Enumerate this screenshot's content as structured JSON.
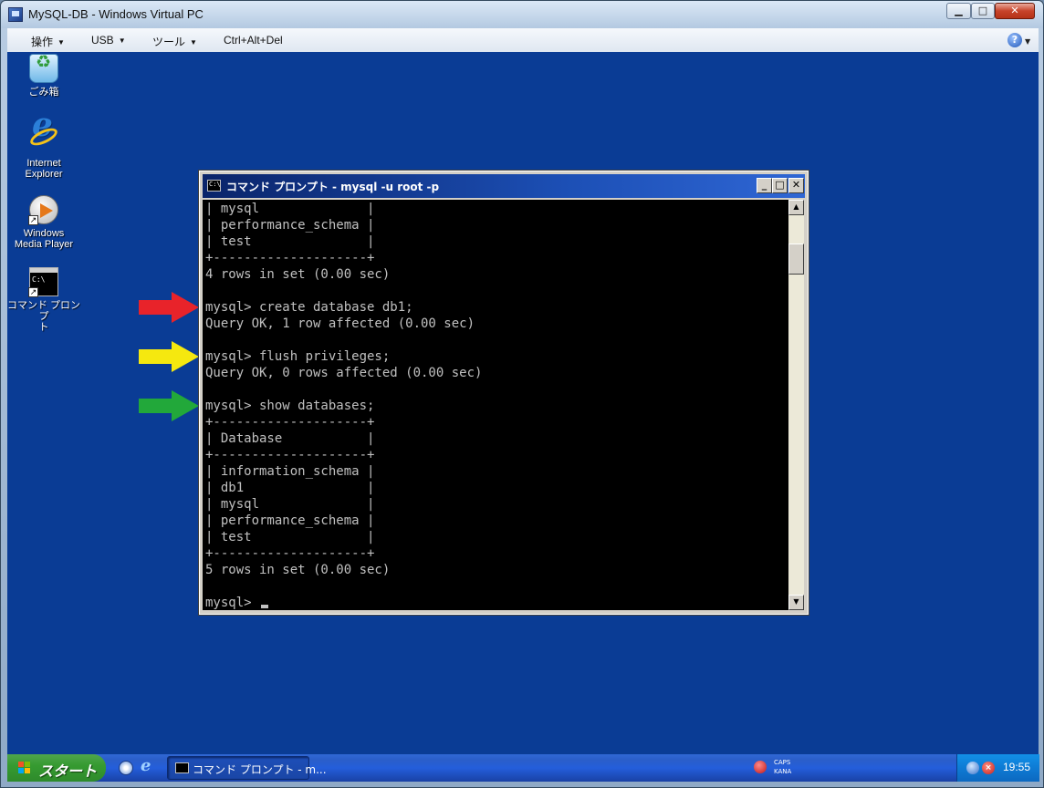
{
  "host": {
    "title": "MySQL-DB - Windows Virtual PC",
    "menu": [
      {
        "label": "操作"
      },
      {
        "label": "USB"
      },
      {
        "label": "ツール"
      },
      {
        "label": "Ctrl+Alt+Del"
      }
    ],
    "help_icon": "help-icon",
    "controls": {
      "minimize": "▁",
      "maximize": "□",
      "close": "✕"
    }
  },
  "desktop": {
    "background": "#0a3c95",
    "icons": [
      {
        "name": "recycle-bin-icon",
        "label": "ごみ箱"
      },
      {
        "name": "internet-explorer-icon",
        "label": "Internet\nExplorer"
      },
      {
        "name": "windows-media-player-icon",
        "label": "Windows\nMedia Player"
      },
      {
        "name": "command-prompt-icon",
        "label": "コマンド プロンプ\nト"
      }
    ],
    "arrows": [
      {
        "color": "#e8232a"
      },
      {
        "color": "#f5e80f"
      },
      {
        "color": "#22a83a"
      }
    ]
  },
  "console": {
    "title": "コマンド プロンプト - mysql -u root -p",
    "icon_text": "C:\\",
    "controls": {
      "minimize": "_",
      "maximize": "□",
      "close": "✕"
    },
    "output": "| mysql              |\n| performance_schema |\n| test               |\n+--------------------+\n4 rows in set (0.00 sec)\n\nmysql> create database db1;\nQuery OK, 1 row affected (0.00 sec)\n\nmysql> flush privileges;\nQuery OK, 0 rows affected (0.00 sec)\n\nmysql> show databases;\n+--------------------+\n| Database           |\n+--------------------+\n| information_schema |\n| db1                |\n| mysql              |\n| performance_schema |\n| test               |\n+--------------------+\n5 rows in set (0.00 sec)\n\n",
    "prompt": "mysql> ",
    "scrollbar": {
      "up": "▲",
      "down": "▼"
    }
  },
  "taskbar": {
    "start_label": "スタート",
    "task_button": "コマンド プロンプト - m...",
    "ime": {
      "caps": "CAPS",
      "kana": "KANA"
    },
    "clock": "19:55"
  }
}
